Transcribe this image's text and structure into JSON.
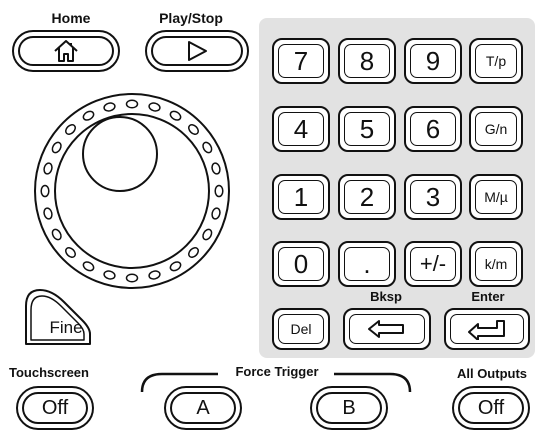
{
  "top_buttons": {
    "home_label": "Home",
    "play_stop_label": "Play/Stop",
    "home_icon": "home-icon",
    "play_icon": "play-icon"
  },
  "knob": {
    "fine_label": "Fine"
  },
  "keypad": {
    "row1": [
      "7",
      "8",
      "9",
      "T/p"
    ],
    "row2": [
      "4",
      "5",
      "6",
      "G/n"
    ],
    "row3": [
      "1",
      "2",
      "3",
      "M/µ"
    ],
    "row4": [
      "0",
      ".",
      "+/-",
      "k/m"
    ],
    "del_label": "Del",
    "bksp_label": "Bksp",
    "enter_label": "Enter",
    "bksp_icon": "backspace-arrow-icon",
    "enter_icon": "enter-arrow-icon"
  },
  "bottom": {
    "touchscreen_label": "Touchscreen",
    "touchscreen_button": "Off",
    "force_trigger_label": "Force Trigger",
    "trigger_a": "A",
    "trigger_b": "B",
    "all_outputs_label": "All Outputs",
    "all_outputs_button": "Off"
  }
}
